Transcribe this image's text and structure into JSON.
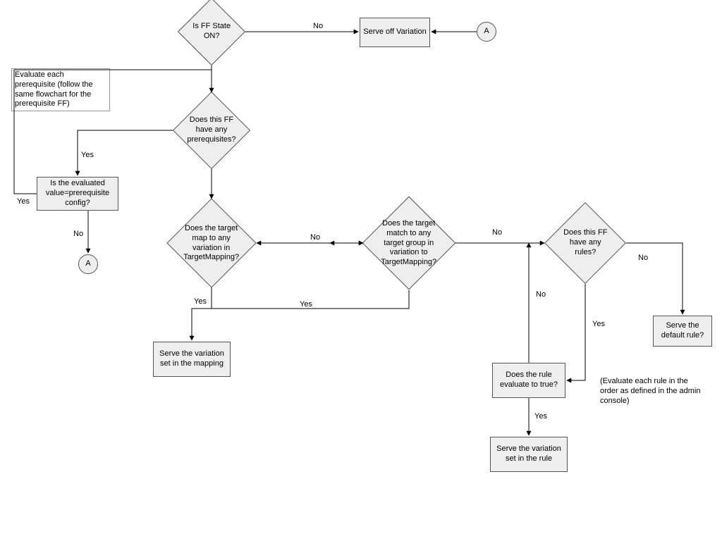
{
  "nodes": {
    "d_state": "Is FF State ON?",
    "p_serve_off": "Serve off Variation",
    "c_A1": "A",
    "d_prereq": "Does this FF have any prerequisites?",
    "p_eval_val": "Is the evaluated value=prerequisite config?",
    "c_A2": "A",
    "d_target_map": "Does the target map to any variation in TargetMapping?",
    "d_target_grp": "Does the target match to any target group in variation to TargetMapping?",
    "d_has_rules": "Does this FF have any rules?",
    "p_serve_map": "Serve the variation set in the mapping",
    "p_rule_true": "Does the rule evaluate to true?",
    "p_serve_rule": "Serve the variation set in the rule",
    "p_serve_def": "Serve the default rule?"
  },
  "edge_labels": {
    "state_no": "No",
    "prereq_yes": "Yes",
    "eval_yes": "Yes",
    "eval_no": "No",
    "tmap_no": "No",
    "tmap_yes": "Yes",
    "tgrp_yes": "Yes",
    "tgrp_no": "No",
    "rules_no": "No",
    "rules_yes": "Yes",
    "rule_true_yes": "Yes",
    "rule_true_no": "No"
  },
  "notes": {
    "prereq_note": "Evaluate each prerequisite (follow the same flowchart for the prerequisite FF)",
    "rules_note": "(Evaluate each rule in the order as defined in the admin console)"
  }
}
